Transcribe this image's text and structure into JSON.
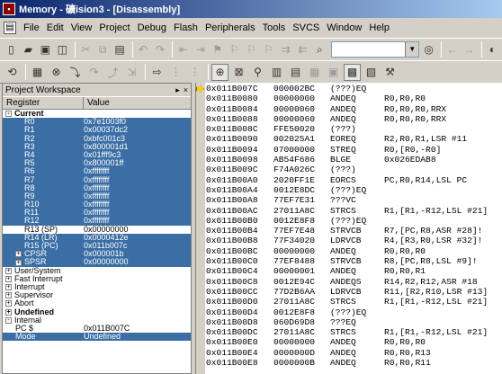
{
  "window": {
    "title": "Memory - 礦ision3 - [Disassembly]"
  },
  "menu": [
    "File",
    "Edit",
    "View",
    "Project",
    "Debug",
    "Flash",
    "Peripherals",
    "Tools",
    "SVCS",
    "Window",
    "Help"
  ],
  "toolbar1": {
    "icons": [
      "new-file-icon",
      "open-file-icon",
      "save-icon",
      "save-all-icon",
      "cut-icon",
      "copy-icon",
      "paste-icon",
      "undo-icon",
      "redo-icon",
      "back-icon",
      "forward-icon",
      "bookmark-icon",
      "prev-bookmark-icon",
      "next-bookmark-icon",
      "clear-bookmarks-icon",
      "indent-icon",
      "unindent-icon",
      "find-in-files-icon",
      "find-icon",
      "search-back-icon",
      "search-forward-icon",
      "goto-icon",
      "stop-icon"
    ]
  },
  "toolbar2": {
    "icons": [
      "reset-icon",
      "run-icon",
      "stop-run-icon",
      "step-into-icon",
      "step-over-icon",
      "step-out-icon",
      "run-to-cursor-icon",
      "show-next-icon",
      "insert-breakpoint-icon",
      "kill-breakpoints-icon",
      "disassembly-window-icon",
      "watch-window-icon",
      "symbols-icon",
      "registers-icon",
      "call-stack-icon",
      "memory-window-icon",
      "serial-window-icon",
      "perf-analyzer-icon",
      "logic-analyzer-icon",
      "toolbox-icon"
    ]
  },
  "workspace": {
    "title": "Project Workspace",
    "col_register": "Register",
    "col_value": "Value",
    "rows": [
      {
        "name": "Current",
        "value": "",
        "level": 1,
        "expander": "-",
        "bold": true,
        "sel": false
      },
      {
        "name": "R0",
        "value": "0x7e1003f0",
        "level": 3,
        "sel": true
      },
      {
        "name": "R1",
        "value": "0x00037dc2",
        "level": 3,
        "sel": true
      },
      {
        "name": "R2",
        "value": "0xbfc001c3",
        "level": 3,
        "sel": true
      },
      {
        "name": "R3",
        "value": "0x800001d1",
        "level": 3,
        "sel": true
      },
      {
        "name": "R4",
        "value": "0x01fff9c3",
        "level": 3,
        "sel": true
      },
      {
        "name": "R5",
        "value": "0x800001ff",
        "level": 3,
        "sel": true
      },
      {
        "name": "R6",
        "value": "0xffffffff",
        "level": 3,
        "sel": true
      },
      {
        "name": "R7",
        "value": "0xffffffff",
        "level": 3,
        "sel": true
      },
      {
        "name": "R8",
        "value": "0xffffffff",
        "level": 3,
        "sel": true
      },
      {
        "name": "R9",
        "value": "0xffffffff",
        "level": 3,
        "sel": true
      },
      {
        "name": "R10",
        "value": "0xffffffff",
        "level": 3,
        "sel": true
      },
      {
        "name": "R11",
        "value": "0xffffffff",
        "level": 3,
        "sel": true
      },
      {
        "name": "R12",
        "value": "0xffffffff",
        "level": 3,
        "sel": true
      },
      {
        "name": "R13 (SP)",
        "value": "0x00000000",
        "level": 3,
        "sel": false
      },
      {
        "name": "R14 (LR)",
        "value": "0x0000412e",
        "level": 3,
        "sel": true
      },
      {
        "name": "R15 (PC)",
        "value": "0x011b007c",
        "level": 3,
        "sel": true
      },
      {
        "name": "CPSR",
        "value": "0x000001b",
        "level": 2,
        "expander": "+",
        "sel": true
      },
      {
        "name": "SPSR",
        "value": "0x00000000",
        "level": 2,
        "expander": "+",
        "sel": true
      },
      {
        "name": "User/System",
        "value": "",
        "level": 1,
        "expander": "+",
        "sel": false
      },
      {
        "name": "Fast Interrupt",
        "value": "",
        "level": 1,
        "expander": "+",
        "sel": false
      },
      {
        "name": "Interrupt",
        "value": "",
        "level": 1,
        "expander": "+",
        "sel": false
      },
      {
        "name": "Supervisor",
        "value": "",
        "level": 1,
        "expander": "+",
        "sel": false
      },
      {
        "name": "Abort",
        "value": "",
        "level": 1,
        "expander": "+",
        "sel": false
      },
      {
        "name": "Undefined",
        "value": "",
        "level": 1,
        "expander": "+",
        "bold": true,
        "sel": false
      },
      {
        "name": "Internal",
        "value": "",
        "level": 1,
        "expander": "-",
        "sel": false
      },
      {
        "name": "PC $",
        "value": "0x011B007C",
        "level": 2,
        "sel": false
      },
      {
        "name": "Mode",
        "value": "Undefined",
        "level": 2,
        "sel": true
      }
    ]
  },
  "disassembly": {
    "lines": [
      {
        "addr": "0x011B007C",
        "code": "000002BC",
        "mn": "(???)EQ",
        "ops": ""
      },
      {
        "addr": "0x011B0080",
        "code": "00000000",
        "mn": "ANDEQ",
        "ops": "R0,R0,R0"
      },
      {
        "addr": "0x011B0084",
        "code": "00000060",
        "mn": "ANDEQ",
        "ops": "R0,R0,R0,RRX"
      },
      {
        "addr": "0x011B0088",
        "code": "00000060",
        "mn": "ANDEQ",
        "ops": "R0,R0,R0,RRX"
      },
      {
        "addr": "0x011B008C",
        "code": "FFE50020",
        "mn": "(???)",
        "ops": ""
      },
      {
        "addr": "0x011B0090",
        "code": "002025A1",
        "mn": "EOREQ",
        "ops": "R2,R0,R1,LSR #11"
      },
      {
        "addr": "0x011B0094",
        "code": "07000000",
        "mn": "STREQ",
        "ops": "R0,[R0,-R0]"
      },
      {
        "addr": "0x011B0098",
        "code": "AB54F686",
        "mn": "BLGE",
        "ops": "0x026EDAB8"
      },
      {
        "addr": "0x011B009C",
        "code": "F74A026C",
        "mn": "(???)",
        "ops": ""
      },
      {
        "addr": "0x011B00A0",
        "code": "2020FF1E",
        "mn": "EORCS",
        "ops": "PC,R0,R14,LSL PC"
      },
      {
        "addr": "0x011B00A4",
        "code": "0012E8DC",
        "mn": "(???)EQ",
        "ops": ""
      },
      {
        "addr": "0x011B00A8",
        "code": "77EF7E31",
        "mn": "???VC",
        "ops": ""
      },
      {
        "addr": "0x011B00AC",
        "code": "27011A8C",
        "mn": "STRCS",
        "ops": "R1,[R1,-R12,LSL #21]"
      },
      {
        "addr": "0x011B00B0",
        "code": "0012E8F8",
        "mn": "(???)EQ",
        "ops": ""
      },
      {
        "addr": "0x011B00B4",
        "code": "77EF7E48",
        "mn": "STRVCB",
        "ops": "R7,[PC,R8,ASR #28]!"
      },
      {
        "addr": "0x011B00B8",
        "code": "77F34020",
        "mn": "LDRVCB",
        "ops": "R4,[R3,R0,LSR #32]!"
      },
      {
        "addr": "0x011B00BC",
        "code": "00000000",
        "mn": "ANDEQ",
        "ops": "R0,R0,R0"
      },
      {
        "addr": "0x011B00C0",
        "code": "77EF8488",
        "mn": "STRVCB",
        "ops": "R8,[PC,R8,LSL #9]!"
      },
      {
        "addr": "0x011B00C4",
        "code": "00000001",
        "mn": "ANDEQ",
        "ops": "R0,R0,R1"
      },
      {
        "addr": "0x011B00C8",
        "code": "0012E94C",
        "mn": "ANDEQS",
        "ops": "R14,R2,R12,ASR #18"
      },
      {
        "addr": "0x011B00CC",
        "code": "77D2B6AA",
        "mn": "LDRVCB",
        "ops": "R11,[R2,R10,LSR #13]"
      },
      {
        "addr": "0x011B00D0",
        "code": "27011A8C",
        "mn": "STRCS",
        "ops": "R1,[R1,-R12,LSL #21]"
      },
      {
        "addr": "0x011B00D4",
        "code": "0012E8F8",
        "mn": "(???)EQ",
        "ops": ""
      },
      {
        "addr": "0x011B00D8",
        "code": "060D69D8",
        "mn": "???EQ",
        "ops": ""
      },
      {
        "addr": "0x011B00DC",
        "code": "27011A8C",
        "mn": "STRCS",
        "ops": "R1,[R1,-R12,LSL #21]"
      },
      {
        "addr": "0x011B00E0",
        "code": "00000000",
        "mn": "ANDEQ",
        "ops": "R0,R0,R0"
      },
      {
        "addr": "0x011B00E4",
        "code": "0000000D",
        "mn": "ANDEQ",
        "ops": "R0,R0,R13"
      },
      {
        "addr": "0x011B00E8",
        "code": "0000000B",
        "mn": "ANDEQ",
        "ops": "R0,R0,R11"
      }
    ]
  }
}
